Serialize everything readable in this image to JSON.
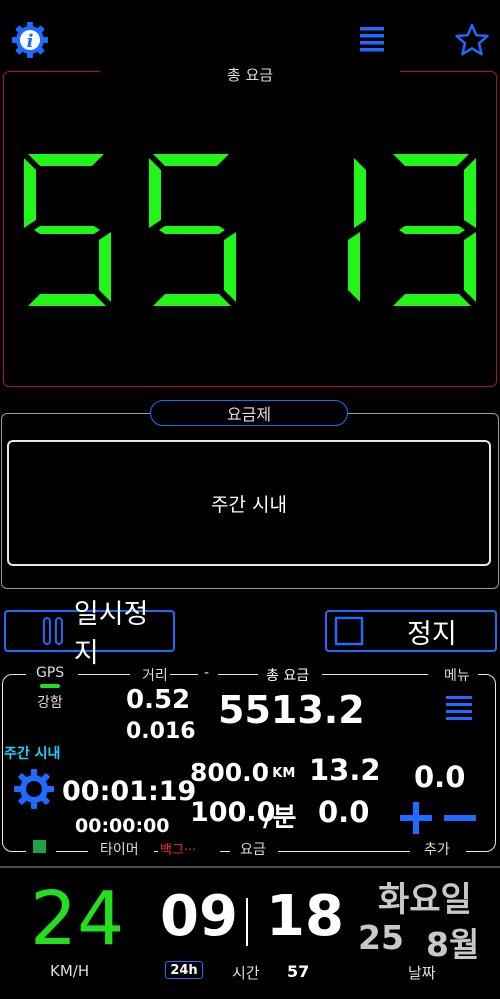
{
  "top_bar": {
    "info_icon": "info-gear-icon",
    "menu_icon": "hamburger-icon",
    "favorite_icon": "star-outline-icon",
    "accent": "#1e6cff"
  },
  "fare_panel": {
    "title": "총 요금",
    "display_digits": [
      "5",
      "5",
      "1",
      "3"
    ],
    "digit_color": "#22f51a",
    "border_color": "#b3121f"
  },
  "rate": {
    "title": "요금제",
    "value": "주간 시내"
  },
  "controls": {
    "pause_label": "일시정지",
    "stop_label": "정지"
  },
  "info": {
    "gps_label": "GPS",
    "gps_strength": "강함",
    "distance_label": "거리",
    "distance_total": "0.52",
    "distance_sub": "0.016",
    "dash": "-",
    "total_fare_label": "총 요금",
    "total_fare": "5513.2",
    "menu_label": "메뉴",
    "mode": "주간 시내",
    "elapsed": "00:01:19",
    "stopped_time": "00:00:00",
    "rate_per_km": "800.0",
    "rate_per_km_unit": "/ KM",
    "km_value": "13.2",
    "rate_per_min": "100.0",
    "rate_per_min_unit": "/분",
    "min_value": "0.0",
    "extra_value": "0.0",
    "timer_label": "타이머",
    "background_label": "백그···",
    "fare_label": "요금",
    "extra_label": "추가",
    "status_color": "#1fa14a"
  },
  "bottom": {
    "speed": "24",
    "speed_unit": "KM/H",
    "hour": "09",
    "minute": "18",
    "seconds": "57",
    "format_badge": "24h",
    "time_label": "시간",
    "weekday": "화요일",
    "day": "25",
    "month": "8월",
    "date_label": "날짜"
  }
}
